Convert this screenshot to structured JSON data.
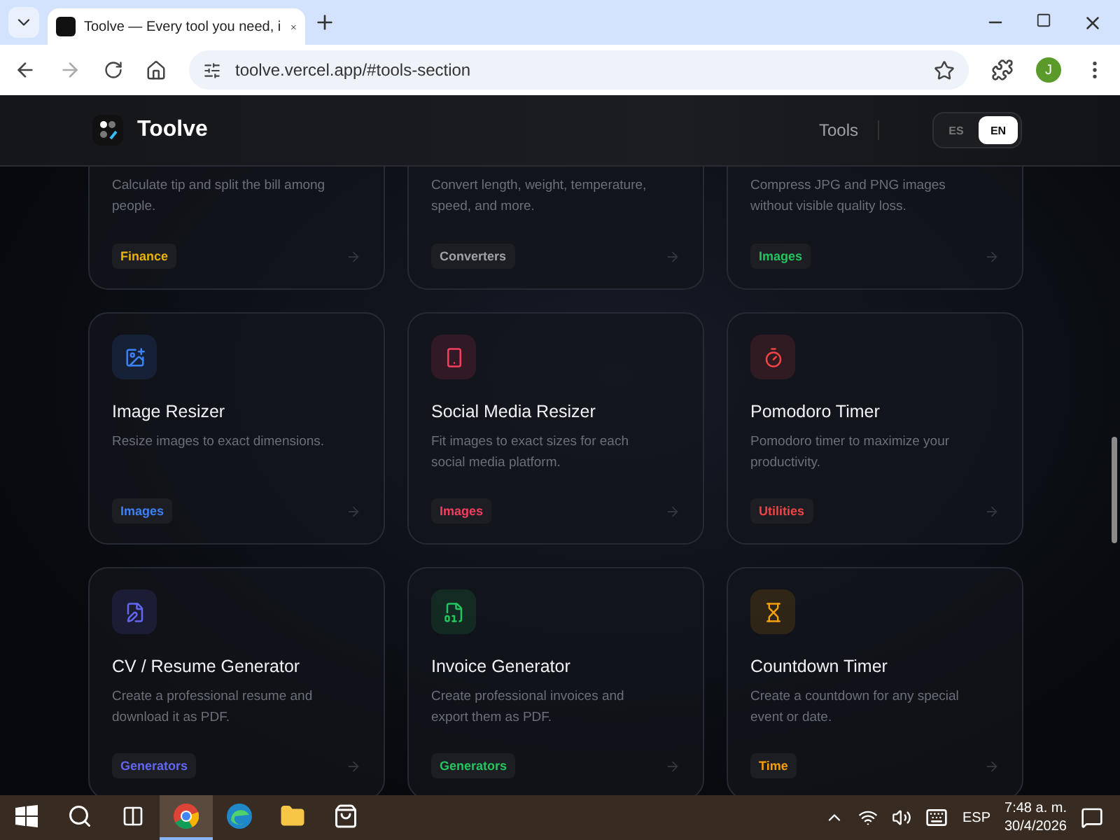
{
  "browser": {
    "tab_title": "Toolve — Every tool you need, i",
    "url": "toolve.vercel.app/#tools-section",
    "avatar": "J"
  },
  "header": {
    "brand": "Toolve",
    "nav": [
      "Tools"
    ],
    "languages": [
      {
        "label": "ES",
        "selected": false
      },
      {
        "label": "EN",
        "selected": true
      }
    ]
  },
  "cards": [
    {
      "kind": "partial",
      "description": "Calculate tip and split the bill among people.",
      "tag": "Finance",
      "color": "#eab308"
    },
    {
      "kind": "partial",
      "description": "Convert length, weight, temperature, speed, and more.",
      "tag": "Converters",
      "color": "#a1a1aa"
    },
    {
      "kind": "partial",
      "description": "Compress JPG and PNG images without visible quality loss.",
      "tag": "Images",
      "color": "#22c55e"
    },
    {
      "kind": "image",
      "title": "Image Resizer",
      "description": "Resize images to exact dimensions.",
      "tag": "Images",
      "color": "#3b82f6"
    },
    {
      "kind": "phone",
      "title": "Social Media Resizer",
      "description": "Fit images to exact sizes for each social media platform.",
      "tag": "Images",
      "color": "#f43f5e"
    },
    {
      "kind": "timer",
      "title": "Pomodoro Timer",
      "description": "Pomodoro timer to maximize your productivity.",
      "tag": "Utilities",
      "color": "#ef4444"
    },
    {
      "kind": "file-pen",
      "title": "CV / Resume Generator",
      "description": "Create a professional resume and download it as PDF.",
      "tag": "Generators",
      "color": "#6366f1"
    },
    {
      "kind": "file-digits",
      "title": "Invoice Generator",
      "description": "Create professional invoices and export them as PDF.",
      "tag": "Generators",
      "color": "#22c55e"
    },
    {
      "kind": "hourglass",
      "title": "Countdown Timer",
      "description": "Create a countdown for any special event or date.",
      "tag": "Time",
      "color": "#f59e0b"
    }
  ],
  "taskbar": {
    "apps": [
      {
        "kind": "search",
        "selected": false
      },
      {
        "kind": "taskview",
        "selected": false
      },
      {
        "kind": "chrome",
        "selected": true
      },
      {
        "kind": "edge",
        "selected": false
      },
      {
        "kind": "folder",
        "selected": false
      },
      {
        "kind": "store",
        "selected": false
      }
    ],
    "language": "ESP",
    "time": "7:48 a. m.",
    "date": "30/4/2026"
  }
}
